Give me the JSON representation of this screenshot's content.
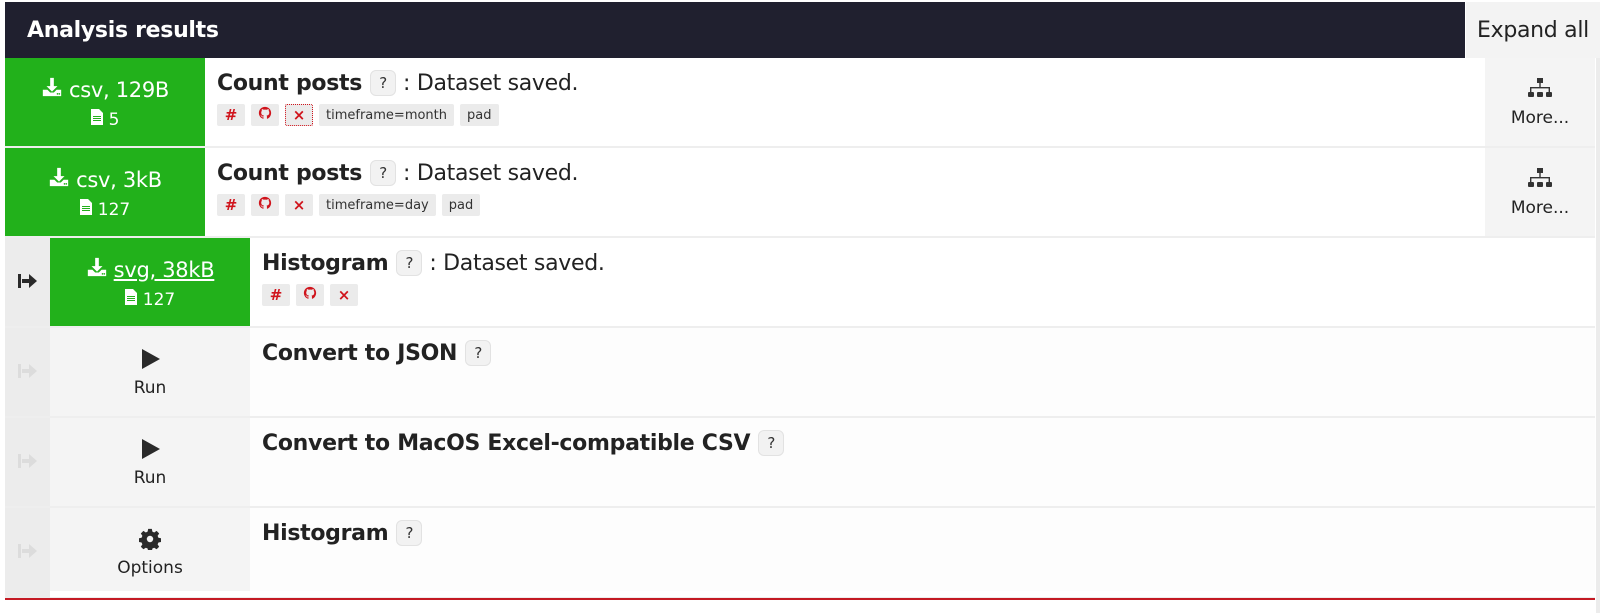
{
  "header": {
    "title": "Analysis results",
    "expand_all_label": "Expand all"
  },
  "colors": {
    "header_bg": "#20202f",
    "success_green": "#22b11b",
    "tag_icon_red": "#d0141c",
    "bottom_border_red": "#c41a24"
  },
  "results": [
    {
      "download_label": "csv, 129B",
      "row_count": "5",
      "processor": "Count posts",
      "help": "?",
      "status": ": Dataset saved.",
      "tags": {
        "hash": "#",
        "github": "github-icon",
        "delete": "×",
        "params": [
          "timeframe=month",
          "pad"
        ]
      },
      "more_label": "More..."
    },
    {
      "download_label": "csv, 3kB",
      "row_count": "127",
      "processor": "Count posts",
      "help": "?",
      "status": ": Dataset saved.",
      "tags": {
        "hash": "#",
        "github": "github-icon",
        "delete": "×",
        "params": [
          "timeframe=day",
          "pad"
        ]
      },
      "more_label": "More..."
    },
    {
      "download_label": "svg, 38kB",
      "row_count": "127",
      "processor": "Histogram",
      "help": "?",
      "status": ": Dataset saved.",
      "tags": {
        "hash": "#",
        "github": "github-icon",
        "delete": "×"
      }
    }
  ],
  "available_processors": [
    {
      "action_label": "Run",
      "action_icon": "play-icon",
      "name": "Convert to JSON",
      "help": "?"
    },
    {
      "action_label": "Run",
      "action_icon": "play-icon",
      "name": "Convert to MacOS Excel-compatible CSV",
      "help": "?"
    },
    {
      "action_label": "Options",
      "action_icon": "gear-icon",
      "name": "Histogram",
      "help": "?"
    }
  ]
}
